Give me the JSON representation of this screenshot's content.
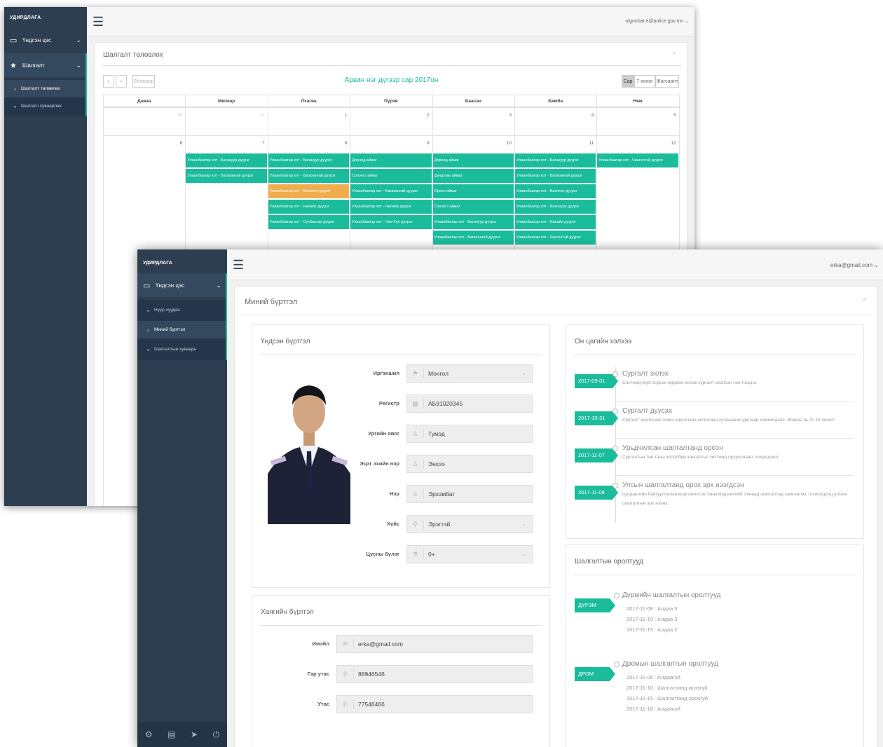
{
  "back": {
    "brand": "УДИРДЛАГА",
    "sidebar": [
      {
        "icon": "monitor-icon",
        "label": "Үндсэн цэс"
      },
      {
        "icon": "star-icon",
        "label": "Шалгалт"
      }
    ],
    "sub_items": [
      "Шалгалт төлөвлөх",
      "Шалгагч хуваарлах"
    ],
    "user": "otgonbat.e@police.gov.mn",
    "panel_title": "Шалгалт төлөвлөх",
    "calendar": {
      "title": "Арван нэг дүгээр сар 2017он",
      "today": "Өнөөдөр",
      "views": [
        "Сар",
        "7 хоног",
        "Жагсаалт"
      ],
      "weekdays": [
        "Даваа",
        "Мягмар",
        "Лхагва",
        "Пүрэв",
        "Баасан",
        "Бямба",
        "Ням"
      ],
      "week1": [
        "30",
        "31",
        "1",
        "2",
        "3",
        "4",
        "5"
      ],
      "week2": [
        "6",
        "7",
        "8",
        "9",
        "10",
        "11",
        "12"
      ],
      "events": {
        "tue": [
          "Улаанбаатар хот - Багануур дүүрэг",
          "Улаанбаатар хот - Багахангай дүүрэг"
        ],
        "wed": [
          "Улаанбаатар хот - Багануур дүүрэг",
          "Улаанбаатар хот - Багахангай дүүрэг",
          "Улаанбаатар хот - Баянгол дүүрэг",
          "Улаанбаатар хот - Налайх дүүрэг",
          "Улаанбаатар хот - Сүхбаатар дүүрэг"
        ],
        "thu": [
          "Дорнод аймаг",
          "Сэлэнгэ аймаг",
          "Улаанбаатар хот - Багахангай дүүрэг",
          "Улаанбаатар хот - Налайх дүүрэг",
          "Улаанбаатар хот - Хан-Уул дүүрэг"
        ],
        "fri": [
          "Дорнод аймаг",
          "Дундговь аймаг",
          "Орхон аймаг",
          "Сэлэнгэ аймаг",
          "Улаанбаатар хот - Багануур дүүрэг",
          "Улаанбаатар хот - Багахангай дүүрэг"
        ],
        "sat": [
          "Улаанбаатар хот - Багануур дүүрэг",
          "Улаанбаатар хот - Багахангай дүүрэг",
          "Улаанбаатар хот - Баянгол дүүрэг",
          "Улаанбаатар хот - Баянзүрх дүүрэг",
          "Улаанбаатар хот - Налайх дүүрэг",
          "Улаанбаатар хот - Чингэлтэй дүүрэг"
        ],
        "sun": [
          "Улаанбаатар хот - Чингэлтэй дүүрэг"
        ]
      }
    }
  },
  "front": {
    "brand": "УДИРДЛАГА",
    "menu": "Үндсэн цэс",
    "sub_items": [
      "Нүүр хуудас",
      "Миний бүртгэл",
      "Шалгалтын хуваарь"
    ],
    "user": "erka@gmail.com",
    "panel_title": "Миний бүртгэл",
    "basic": {
      "title": "Үндсэн бүртгэл",
      "fields": [
        {
          "label": "Иргэншил",
          "value": "Монгол",
          "icon": "flag-icon"
        },
        {
          "label": "Регистр",
          "value": "АБ91020345",
          "icon": "id-card-icon"
        },
        {
          "label": "Ургийн овог",
          "value": "Тумэд",
          "icon": "person-icon"
        },
        {
          "label": "Эцэг эхийн нэр",
          "value": "Энхээ",
          "icon": "person-icon"
        },
        {
          "label": "Нэр",
          "value": "Эрхэмбат",
          "icon": "person-icon"
        },
        {
          "label": "Хүйс",
          "value": "Эрэгтэй",
          "icon": "gender-icon"
        },
        {
          "label": "Цусны бүлэг",
          "value": "0+",
          "icon": "drop-icon"
        }
      ]
    },
    "address": {
      "title": "Хаягийн бүртгэл",
      "fields": [
        {
          "label": "Имэйл",
          "value": "erka@gmail.com",
          "icon": "mail-icon"
        },
        {
          "label": "Гар утас",
          "value": "88946546",
          "icon": "phone-icon"
        },
        {
          "label": "Утас",
          "value": "77546466",
          "icon": "phone-icon"
        }
      ]
    },
    "timeline": {
      "title": "Он цагийн хэлхээ",
      "items": [
        {
          "date": "2017-09-01",
          "title": "Сургалт эхлэх",
          "desc": "Системд бүртгэгдсэн өдрөөс эхлэж сургалт эхэлсэн гэж тооцно."
        },
        {
          "date": "2017-10-31",
          "title": "Сургалт дуусах",
          "desc": "Сургалт эхэлснээс хойш харгалзах ангиллын хугацааны урьтаар хэмжигдэнэ. Жишээ нь /А 14 хоног/"
        },
        {
          "date": "2017-11-07",
          "title": "Урьдчилсан шалгалтанд орсон",
          "desc": "Сургалтын төв таны хөтөлбөр хангалтыг системд оруулснаар тооцогдоно."
        },
        {
          "date": "2017-11-08",
          "title": "Улсын шалгалтанд орох эрх нээгдсэн",
          "desc": "Цагдаагийн байгууллагын мэргэжилтэн таны мэдээллийг хянаад шалгалтад хамгаалах тохиолдолд улсын шалгалтын эрх нээнэ."
        }
      ]
    },
    "exams": {
      "title": "Шалгалтын оролтууд",
      "groups": [
        {
          "badge": "ДҮРЭМ",
          "title": "Дүрмийн шалгалтын оролтууд",
          "lines": [
            "2017-11-08 : Алдаа 5",
            "2017-11-10 : Алдаа 3",
            "2017-11-15 : Алдаа 2"
          ]
        },
        {
          "badge": "ДРОМ",
          "title": "Дромын шалгалтын оролтууд",
          "lines": [
            "2017-11-08 : Алдаагүй",
            "2017-11-10 : Шалгалтанд ирээгүй",
            "2017-11-15 : Шалгалтанд ороогүй",
            "2017-11-18 : Алдаагүй"
          ]
        }
      ]
    },
    "footer_icons": [
      "gear-icon",
      "document-icon",
      "send-icon",
      "power-icon"
    ]
  },
  "colors": {
    "sidebar": "#2c3e50",
    "accent": "#1abc9c",
    "warning": "#f0ad4e"
  }
}
